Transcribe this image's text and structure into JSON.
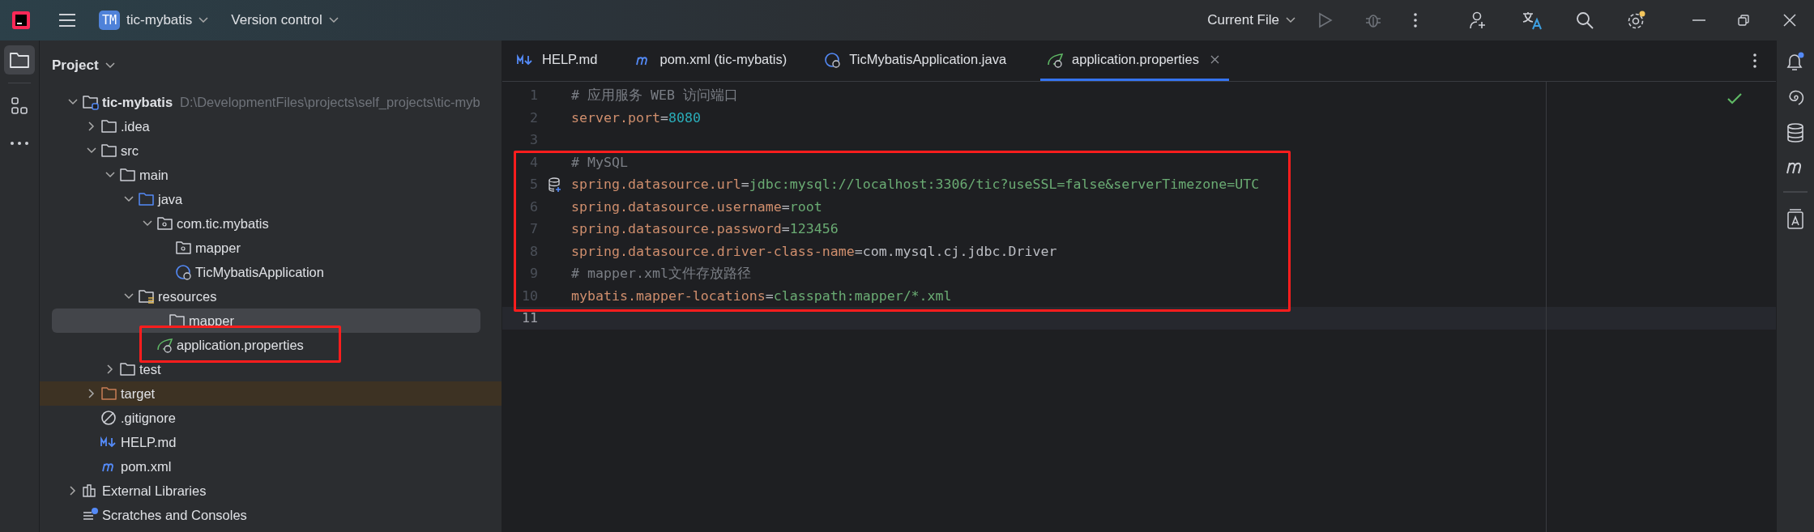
{
  "title_bar": {
    "project_badge": "TM",
    "project": "tic-mybatis",
    "vcs": "Version control",
    "run_config": "Current File"
  },
  "tool_strip_left": [
    {
      "kind": "project",
      "selected": true
    },
    {
      "kind": "structure",
      "selected": false
    },
    {
      "kind": "more",
      "selected": false
    }
  ],
  "project_panel": {
    "title": "Project",
    "tree": [
      {
        "label": "tic-mybatis",
        "path": "D:\\DevelopmentFiles\\projects\\self_projects\\tic-myb",
        "kind": "module",
        "expanded": true,
        "selected": false,
        "children": [
          {
            "label": ".idea",
            "kind": "folder",
            "expanded": false,
            "selected": false
          },
          {
            "label": "src",
            "kind": "folder",
            "expanded": true,
            "selected": false,
            "children": [
              {
                "label": "main",
                "kind": "folder",
                "expanded": true,
                "selected": false,
                "children": [
                  {
                    "label": "java",
                    "kind": "source-folder",
                    "expanded": true,
                    "selected": false,
                    "children": [
                      {
                        "label": "com.tic.mybatis",
                        "kind": "package",
                        "expanded": true,
                        "selected": false,
                        "children": [
                          {
                            "label": "mapper",
                            "kind": "package",
                            "selected": false
                          },
                          {
                            "label": "TicMybatisApplication",
                            "kind": "class",
                            "selected": false
                          }
                        ]
                      }
                    ]
                  },
                  {
                    "label": "resources",
                    "kind": "resources-folder",
                    "expanded": true,
                    "selected": false,
                    "children": [
                      {
                        "label": "mapper",
                        "kind": "folder",
                        "selected": true
                      },
                      {
                        "label": "application.properties",
                        "kind": "spring",
                        "selected": false
                      }
                    ]
                  }
                ]
              },
              {
                "label": "test",
                "kind": "folder",
                "expanded": false,
                "selected": false
              }
            ]
          },
          {
            "label": "target",
            "kind": "excluded-folder",
            "expanded": false,
            "selected": false
          },
          {
            "label": ".gitignore",
            "kind": "ignore",
            "selected": false
          },
          {
            "label": "HELP.md",
            "kind": "markdown",
            "selected": false
          },
          {
            "label": "pom.xml",
            "kind": "maven",
            "selected": false
          }
        ]
      },
      {
        "label": "External Libraries",
        "kind": "libraries",
        "expanded": false,
        "selected": false
      },
      {
        "label": "Scratches and Consoles",
        "kind": "scratches",
        "selected": false
      }
    ]
  },
  "editor": {
    "tabs": [
      {
        "label": "HELP.md",
        "kind": "markdown",
        "selected": false
      },
      {
        "label": "pom.xml (tic-mybatis)",
        "kind": "maven",
        "selected": false
      },
      {
        "label": "TicMybatisApplication.java",
        "kind": "class",
        "selected": false
      },
      {
        "label": "application.properties",
        "kind": "spring",
        "selected": true
      }
    ],
    "lines": [
      {
        "number": "1",
        "current": false,
        "tokens": [
          {
            "kind": "comment",
            "text": "# 应用服务 WEB 访问端口"
          }
        ]
      },
      {
        "number": "2",
        "current": false,
        "tokens": [
          {
            "kind": "key",
            "text": "server.port"
          },
          {
            "kind": "sep",
            "text": "="
          },
          {
            "kind": "number",
            "text": "8080"
          }
        ]
      },
      {
        "number": "3",
        "current": false
      },
      {
        "number": "4",
        "current": false,
        "tokens": [
          {
            "kind": "comment",
            "text": "# MySQL"
          }
        ]
      },
      {
        "number": "5",
        "current": false,
        "datasource_marker": true,
        "tokens": [
          {
            "kind": "key",
            "text": "spring.datasource.url"
          },
          {
            "kind": "sep",
            "text": "="
          },
          {
            "kind": "value",
            "text": "jdbc:mysql://localhost:3306/tic?useSSL=false&serverTimezone=UTC"
          }
        ]
      },
      {
        "number": "6",
        "current": false,
        "tokens": [
          {
            "kind": "key",
            "text": "spring.datasource.username"
          },
          {
            "kind": "sep",
            "text": "="
          },
          {
            "kind": "value",
            "text": "root"
          }
        ]
      },
      {
        "number": "7",
        "current": false,
        "tokens": [
          {
            "kind": "key",
            "text": "spring.datasource.password"
          },
          {
            "kind": "sep",
            "text": "="
          },
          {
            "kind": "value",
            "text": "123456"
          }
        ]
      },
      {
        "number": "8",
        "current": false,
        "tokens": [
          {
            "kind": "key",
            "text": "spring.datasource.driver-class-name"
          },
          {
            "kind": "sep",
            "text": "="
          },
          {
            "kind": "plain",
            "text": "com.mysql.cj.jdbc.Driver"
          }
        ]
      },
      {
        "number": "9",
        "current": false,
        "tokens": [
          {
            "kind": "comment",
            "text": "# mapper.xml文件存放路径"
          }
        ]
      },
      {
        "number": "10",
        "current": false,
        "tokens": [
          {
            "kind": "key",
            "text": "mybatis.mapper-locations"
          },
          {
            "kind": "sep",
            "text": "="
          },
          {
            "kind": "value",
            "text": "classpath:mapper/*.xml"
          }
        ]
      },
      {
        "number": "11",
        "current": true
      }
    ]
  }
}
